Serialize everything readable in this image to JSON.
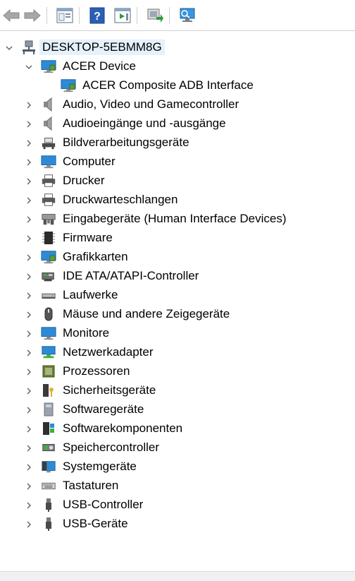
{
  "toolbar": {
    "buttons": [
      "back",
      "forward",
      "properties",
      "help",
      "run",
      "update-driver",
      "scan-hardware"
    ]
  },
  "tree": {
    "root": "DESKTOP-5EBMM8G",
    "expanded_category": "ACER Device",
    "expanded_child": "ACER Composite ADB Interface",
    "categories": [
      "Audio, Video und Gamecontroller",
      "Audioeingänge und -ausgänge",
      "Bildverarbeitungsgeräte",
      "Computer",
      "Drucker",
      "Druckwarteschlangen",
      "Eingabegeräte (Human Interface Devices)",
      "Firmware",
      "Grafikkarten",
      "IDE ATA/ATAPI-Controller",
      "Laufwerke",
      "Mäuse und andere Zeigegeräte",
      "Monitore",
      "Netzwerkadapter",
      "Prozessoren",
      "Sicherheitsgeräte",
      "Softwaregeräte",
      "Softwarekomponenten",
      "Speichercontroller",
      "Systemgeräte",
      "Tastaturen",
      "USB-Controller",
      "USB-Geräte"
    ]
  },
  "colors": {
    "selection": "#e5f1fb",
    "chevron": "#606060",
    "monitor": "#2d8ad6"
  }
}
